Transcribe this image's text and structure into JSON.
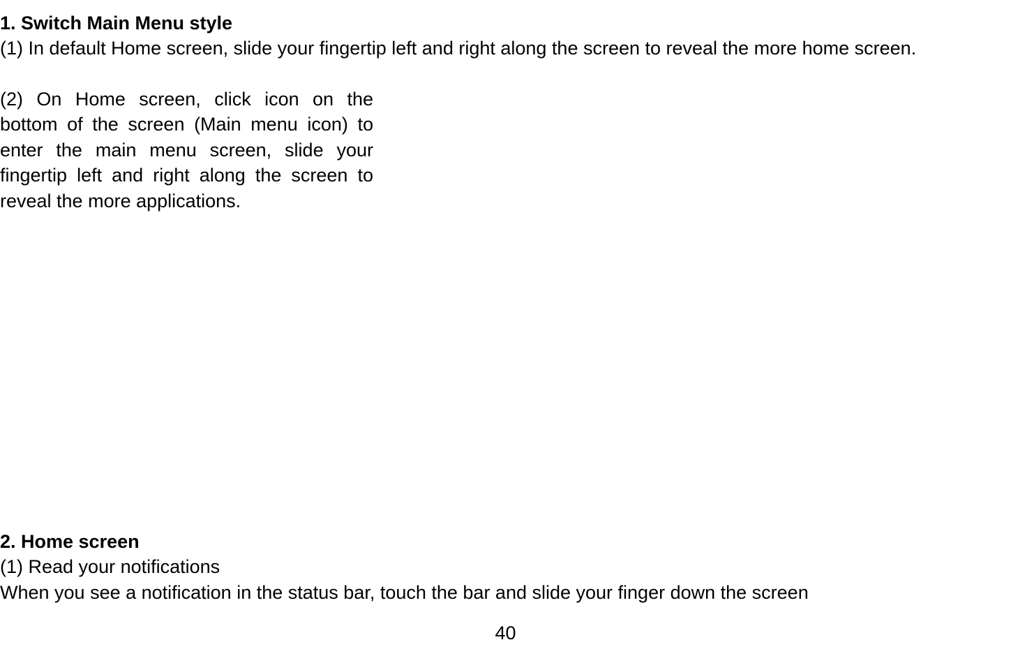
{
  "section1": {
    "heading": "1. Switch Main Menu style",
    "para1": "(1) In default Home screen, slide your fingertip left and right along the screen to reveal the more home screen.",
    "para2_line1": "(2) On Home screen, click icon on the",
    "para2_line2": "bottom of the screen (Main menu icon) to",
    "para2_line3": "enter the main menu screen, slide your",
    "para2_line4": "fingertip left and right along the screen to",
    "para2_line5": "reveal the more applications."
  },
  "section2": {
    "heading": "2. Home screen",
    "para1": "(1) Read your notifications",
    "para2": "When you see a notification in the status bar, touch the bar and slide your finger down the screen"
  },
  "pageNumber": "40"
}
